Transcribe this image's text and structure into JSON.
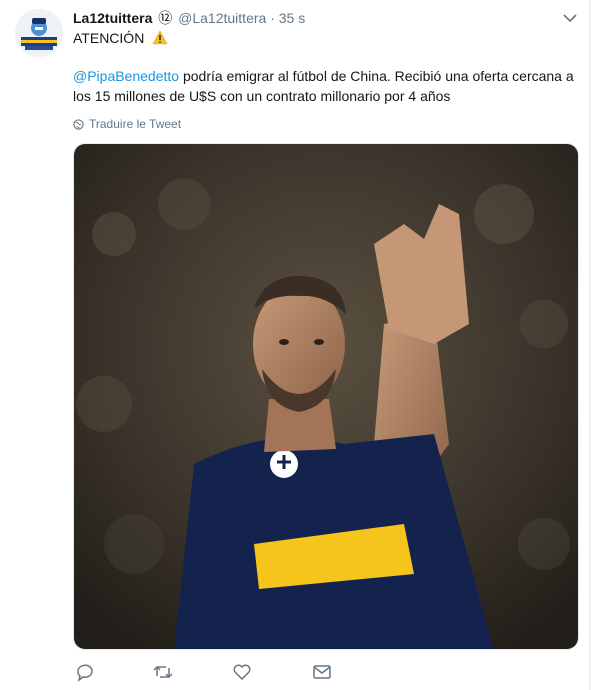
{
  "tweet": {
    "display_name": "La12tuittera",
    "badge": "⑫",
    "handle": "@La12tuittera",
    "separator": "·",
    "time": "35 s",
    "headline": "ATENCIÓN",
    "mention": "@PipaBenedetto",
    "text": " podría emigrar al fútbol de China. Recibió una oferta cercana a los 15 millones de U$S con un contrato millonario por 4 años",
    "translate_label": "Traduire le Tweet"
  },
  "icons": {
    "headline": "warning-icon",
    "caret": "chevron-down-icon",
    "translate": "globe-icon",
    "actions": [
      "reply-icon",
      "retweet-icon",
      "like-icon",
      "message-icon"
    ]
  },
  "colors": {
    "link": "#1b95e0",
    "muted": "#657786",
    "jersey_blue": "#13234d",
    "jersey_yellow": "#f6c51b"
  }
}
